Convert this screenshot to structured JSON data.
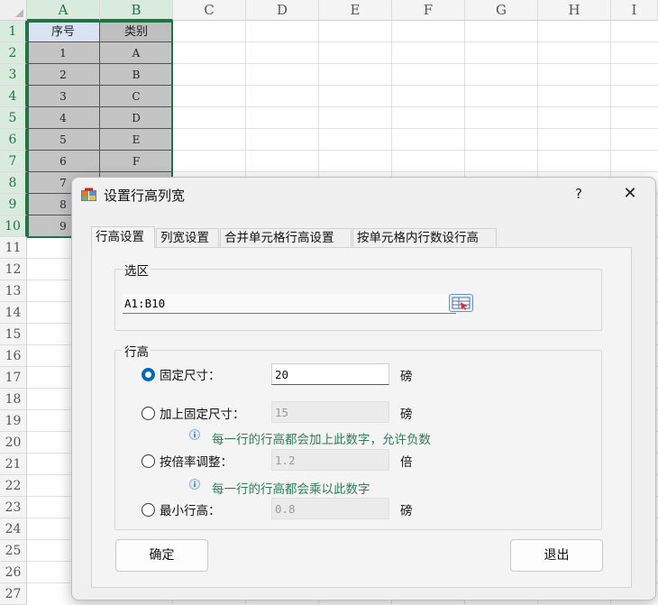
{
  "sheet": {
    "columns": [
      "A",
      "B",
      "C",
      "D",
      "E",
      "F",
      "G",
      "H",
      "I"
    ],
    "rows": [
      "1",
      "2",
      "3",
      "4",
      "5",
      "6",
      "7",
      "8",
      "9",
      "10",
      "11",
      "12",
      "13",
      "14",
      "15",
      "16",
      "17",
      "18",
      "19",
      "20",
      "21",
      "22",
      "23",
      "24",
      "25",
      "26",
      "27"
    ],
    "header_row": [
      "序号",
      "类别"
    ],
    "data_rows": [
      [
        "1",
        "A"
      ],
      [
        "2",
        "B"
      ],
      [
        "3",
        "C"
      ],
      [
        "4",
        "D"
      ],
      [
        "5",
        "E"
      ],
      [
        "6",
        "F"
      ],
      [
        "7",
        ""
      ],
      [
        "8",
        ""
      ],
      [
        "9",
        ""
      ]
    ],
    "colors": {
      "selection": "#217346",
      "header_a": "#dae3f3",
      "header_b": "#bfbfbf",
      "body": "#c4c4c4"
    }
  },
  "dialog": {
    "title": "设置行高列宽",
    "help": "?",
    "close": "✕",
    "tabs": [
      "行高设置",
      "列宽设置",
      "合并单元格行高设置",
      "按单元格内行数设行高"
    ],
    "active_tab": 0,
    "selection_group": {
      "label": "选区",
      "value": "A1:B10"
    },
    "row_height_group": {
      "label": "行高",
      "options": [
        {
          "label": "固定尺寸：",
          "value": "20",
          "unit": "磅",
          "checked": true,
          "enabled": true
        },
        {
          "label": "加上固定尺寸：",
          "value": "15",
          "unit": "磅",
          "checked": false,
          "enabled": false
        },
        {
          "label": "按倍率调整：",
          "value": "1.2",
          "unit": "倍",
          "checked": false,
          "enabled": false
        },
        {
          "label": "最小行高：",
          "value": "0.8",
          "unit": "磅",
          "checked": false,
          "enabled": false
        }
      ],
      "hints": [
        "每一行的行高都会加上此数字，允许负数",
        "每一行的行高都会乘以此数字"
      ]
    },
    "ok_label": "确定",
    "exit_label": "退出",
    "colors": {
      "radio_on": "#0067c0",
      "hint": "#2e7d58"
    }
  }
}
